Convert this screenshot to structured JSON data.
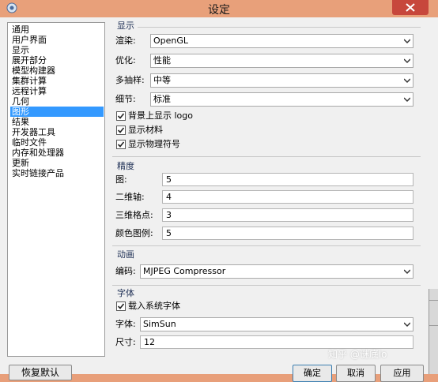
{
  "window": {
    "title": "设定"
  },
  "sidebar": {
    "items": [
      {
        "label": "通用"
      },
      {
        "label": "用户界面"
      },
      {
        "label": "显示"
      },
      {
        "label": "展开部分"
      },
      {
        "label": "模型构建器"
      },
      {
        "label": "集群计算"
      },
      {
        "label": "远程计算"
      },
      {
        "label": "几何"
      },
      {
        "label": "图形",
        "selected": true
      },
      {
        "label": "结果"
      },
      {
        "label": "开发器工具"
      },
      {
        "label": "临时文件"
      },
      {
        "label": "内存和处理器"
      },
      {
        "label": "更新"
      },
      {
        "label": "实时链接产品"
      }
    ],
    "restore_default_label": "恢复默认"
  },
  "display": {
    "header": "显示",
    "render_label": "渲染:",
    "render_value": "OpenGL",
    "optimize_label": "优化:",
    "optimize_value": "性能",
    "msaa_label": "多抽样:",
    "msaa_value": "中等",
    "detail_label": "细节:",
    "detail_value": "标准",
    "cb_logo_label": "背景上显示 logo",
    "cb_logo_checked": true,
    "cb_material_label": "显示材料",
    "cb_material_checked": true,
    "cb_physics_label": "显示物理符号",
    "cb_physics_checked": true
  },
  "precision": {
    "header": "精度",
    "plot_label": "图:",
    "plot_value": "5",
    "axis2d_label": "二维轴:",
    "axis2d_value": "4",
    "grid3d_label": "三维格点:",
    "grid3d_value": "3",
    "legend_label": "颜色图例:",
    "legend_value": "5"
  },
  "animation": {
    "header": "动画",
    "codec_label": "编码:",
    "codec_value": "MJPEG Compressor"
  },
  "font": {
    "header": "字体",
    "cb_system_label": "载入系统字体",
    "cb_system_checked": true,
    "font_label": "字体:",
    "font_value": "SimSun",
    "size_label": "尺寸:",
    "size_value": "12"
  },
  "footer": {
    "ok_label": "确定",
    "cancel_label": "取消",
    "apply_label": "应用"
  },
  "watermark": "知乎 @谜底lo",
  "colors": {
    "selection": "#3399ff",
    "titlebar": "#e8a07a",
    "close": "#c7473c"
  }
}
